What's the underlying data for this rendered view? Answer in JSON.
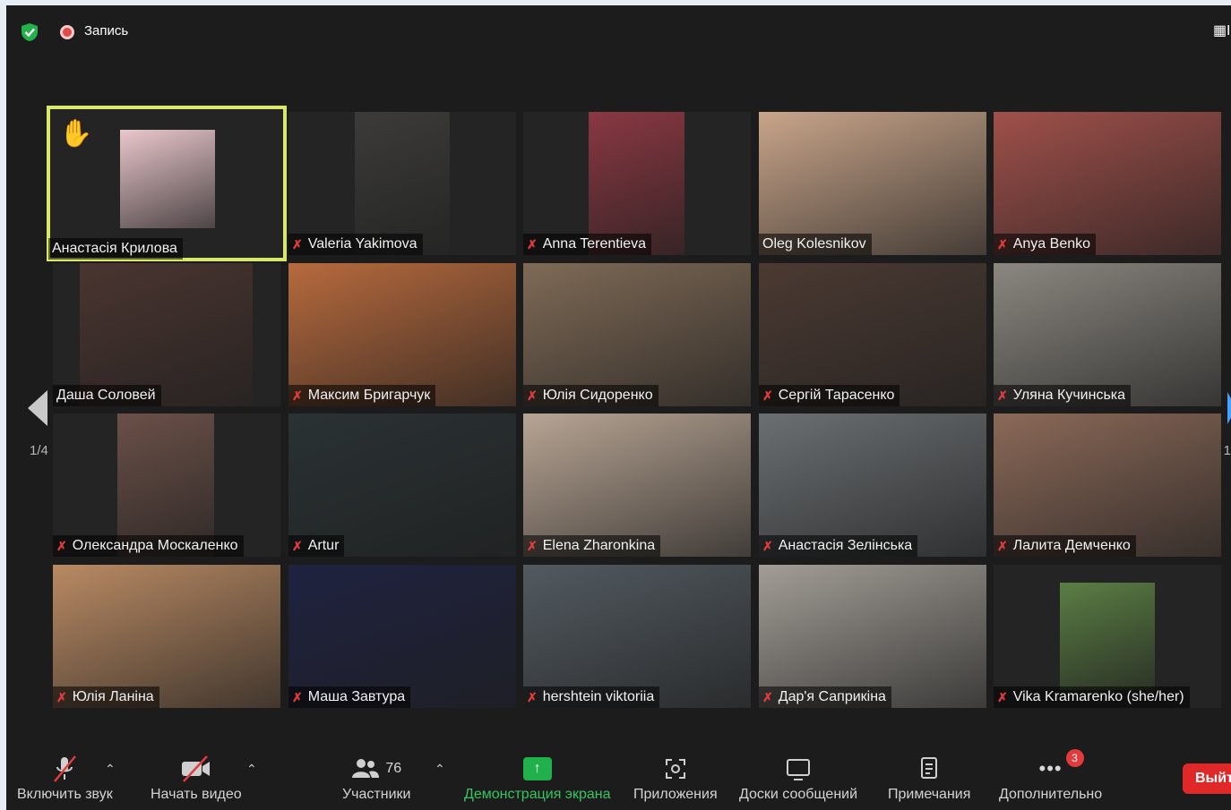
{
  "topbar": {
    "recording_label": "Запись",
    "security_icon": "shield-check-icon",
    "view_icon": "grid-view-icon",
    "view_label": "E"
  },
  "gallery": {
    "page_indicator": "1/4",
    "page_indicator_right": "1",
    "participants": [
      {
        "name": "Анастасія Крилова",
        "muted": false,
        "hand_raised": true,
        "active": true,
        "bg": "#eac7cc"
      },
      {
        "name": "Valeria Yakimova",
        "muted": true,
        "bg": "#3c3b3a"
      },
      {
        "name": "Anna Terentieva",
        "muted": true,
        "bg": "#8a3842"
      },
      {
        "name": "Oleg Kolesnikov",
        "muted": false,
        "bg": "#c9a58a"
      },
      {
        "name": "Anya Benko",
        "muted": true,
        "bg": "#a0504a"
      },
      {
        "name": "Даша Соловей",
        "muted": false,
        "bg": "#4a3530"
      },
      {
        "name": "Максим Бригарчук",
        "muted": true,
        "bg": "#b76a3d"
      },
      {
        "name": "Юлія Сидоренко",
        "muted": true,
        "bg": "#7f6a56"
      },
      {
        "name": "Сергій Тарасенко",
        "muted": true,
        "bg": "#4b3a32"
      },
      {
        "name": "Уляна Кучинська",
        "muted": true,
        "bg": "#8b8780"
      },
      {
        "name": "Олександра Москаленко",
        "muted": true,
        "bg": "#6b5048"
      },
      {
        "name": "Artur",
        "muted": true,
        "bg": "#2a3234"
      },
      {
        "name": "Elena Zharonkina",
        "muted": true,
        "bg": "#b8a594"
      },
      {
        "name": "Анастасія Зелінська",
        "muted": true,
        "bg": "#6b6f72"
      },
      {
        "name": "Лалита Демченко",
        "muted": true,
        "bg": "#8b6958"
      },
      {
        "name": "Юлія Ланіна",
        "muted": true,
        "bg": "#b98a63"
      },
      {
        "name": "Маша Завтура",
        "muted": true,
        "bg": "#1f2240"
      },
      {
        "name": "hershtein viktoriia",
        "muted": true,
        "bg": "#525a60"
      },
      {
        "name": "Дар'я Саприкіна",
        "muted": true,
        "bg": "#a29d96"
      },
      {
        "name": "Vika Kramarenko (she/her)",
        "muted": true,
        "bg": "#5b7e44"
      }
    ]
  },
  "toolbar": {
    "unmute_label": "Включить звук",
    "start_video_label": "Начать видео",
    "participants_label": "Участники",
    "participants_count": "76",
    "share_label": "Демонстрация экрана",
    "apps_label": "Приложения",
    "whiteboards_label": "Доски сообщений",
    "notes_label": "Примечания",
    "more_label": "Дополнительно",
    "more_badge": "3",
    "leave_label": "Выйт",
    "accent_color": "#36c562",
    "leave_color": "#e02828"
  }
}
